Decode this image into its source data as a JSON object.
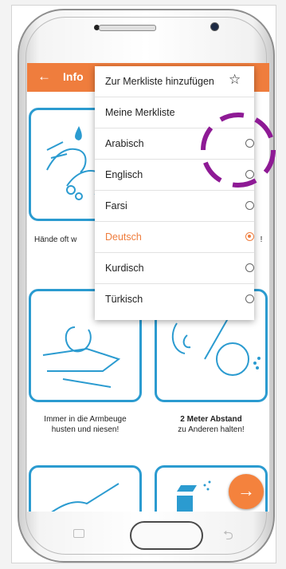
{
  "appbar": {
    "back_icon": "arrow-left-icon",
    "title": "Info"
  },
  "menu": {
    "bookmark_add": "Zur Merkliste hinzufügen",
    "bookmark_list": "Meine Merkliste",
    "languages": [
      {
        "label": "Arabisch",
        "selected": false
      },
      {
        "label": "Englisch",
        "selected": false
      },
      {
        "label": "Farsi",
        "selected": false
      },
      {
        "label": "Deutsch",
        "selected": true
      },
      {
        "label": "Kurdisch",
        "selected": false
      },
      {
        "label": "Türkisch",
        "selected": false
      }
    ]
  },
  "tiles": {
    "wash_caption": "Hände oft w",
    "right_caption_fragment": "!",
    "sneeze_caption_line1": "Immer in die Armbeuge",
    "sneeze_caption_line2": "husten und niesen!",
    "distance_caption_bold": "2 Meter Abstand",
    "distance_caption_rest": "zu Anderen halten!"
  },
  "fab": {
    "icon": "arrow-right-icon",
    "glyph": "→"
  },
  "colors": {
    "accent": "#ef7d3d",
    "tile_border": "#2b9bd0",
    "highlight": "#8e1a95"
  }
}
